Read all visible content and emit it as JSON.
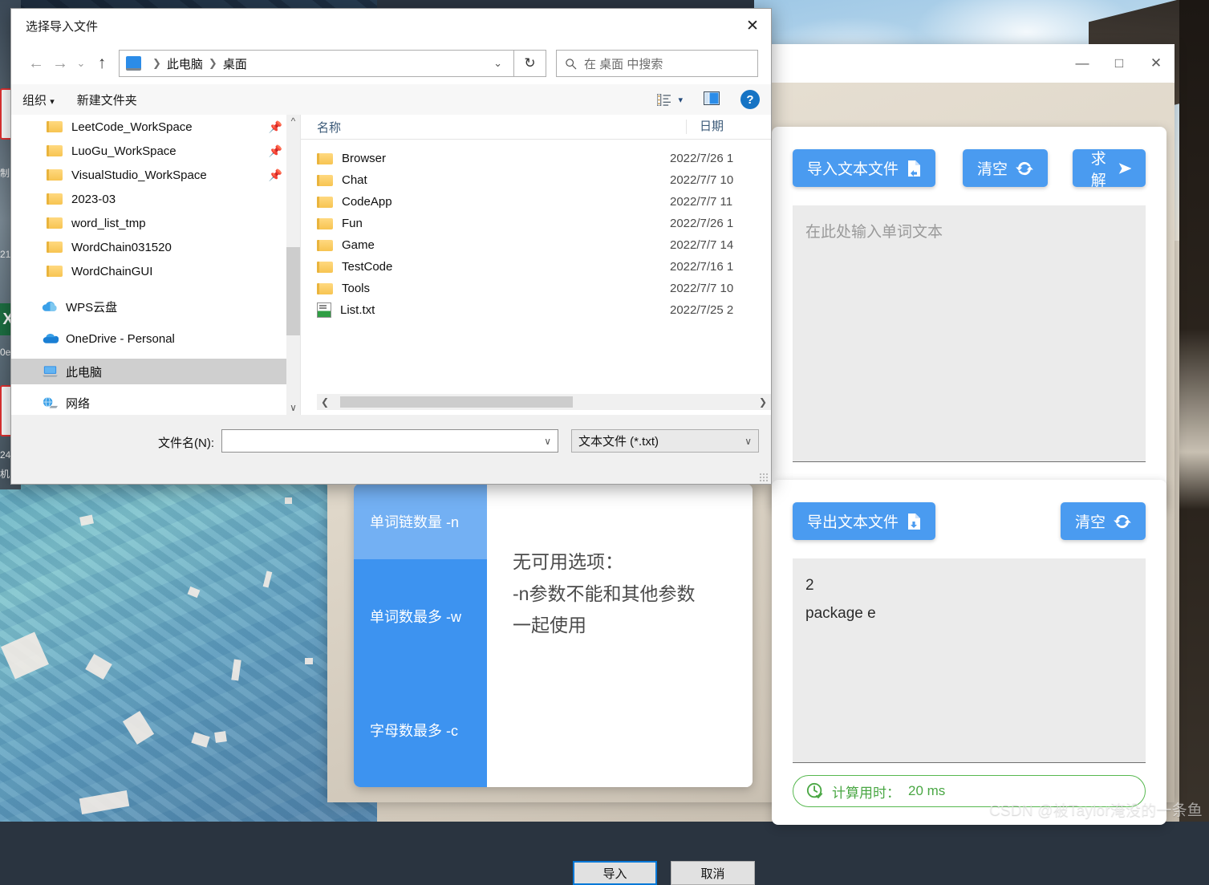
{
  "desktop": {
    "watermark": "CSDN @被Taylor淹没的一条鱼"
  },
  "app_window": {
    "title": "",
    "controls": {
      "minimize": "—",
      "maximize": "□",
      "close": "✕"
    },
    "tab_card": {
      "tabs": [
        {
          "label": "单词链数量 -n",
          "active": true
        },
        {
          "label": "单词数最多 -w",
          "active": false
        },
        {
          "label": "字母数最多 -c",
          "active": false
        }
      ],
      "pane_lines": [
        "无可用选项：",
        "-n参数不能和其他参数",
        "一起使用"
      ]
    },
    "input_card": {
      "import_button": "导入文本文件",
      "clear_button": "清空",
      "solve_button": "求解",
      "textarea_placeholder": "在此处输入单词文本",
      "textarea_value": ""
    },
    "output_card": {
      "export_button": "导出文本文件",
      "clear_button": "清空",
      "textarea_value": "2\npackage e",
      "timer_label": "计算用时：",
      "timer_value": "20 ms",
      "timer_color": "#4aa744"
    },
    "accent_color": "#4a9bf0"
  },
  "file_dialog": {
    "title": "选择导入文件",
    "close_label": "✕",
    "nav": {
      "back": "←",
      "forward": "→",
      "history": "⌄",
      "up": "↑",
      "breadcrumb": [
        "此电脑",
        "桌面"
      ],
      "breadcrumb_caret": "⌄",
      "refresh": "↻",
      "search_placeholder": "在 桌面 中搜索"
    },
    "toolbar": {
      "organize": "组织",
      "organize_caret": "▾",
      "new_folder": "新建文件夹",
      "view_caret": "▾",
      "help": "?"
    },
    "tree": [
      {
        "label": "LeetCode_WorkSpace",
        "icon": "folder-icon",
        "pinned": true
      },
      {
        "label": "LuoGu_WorkSpace",
        "icon": "folder-icon",
        "pinned": true
      },
      {
        "label": "VisualStudio_WorkSpace",
        "icon": "folder-icon",
        "pinned": true
      },
      {
        "label": "2023-03",
        "icon": "folder-icon",
        "pinned": false
      },
      {
        "label": "word_list_tmp",
        "icon": "folder-icon",
        "pinned": false
      },
      {
        "label": "WordChain031520",
        "icon": "folder-icon",
        "pinned": false
      },
      {
        "label": "WordChainGUI",
        "icon": "folder-icon",
        "pinned": false
      },
      {
        "label": "WPS云盘",
        "icon": "cloud-icon",
        "pinned": false
      },
      {
        "label": "OneDrive - Personal",
        "icon": "onedrive-icon",
        "pinned": false
      },
      {
        "label": "此电脑",
        "icon": "computer-icon",
        "pinned": false,
        "selected": true
      },
      {
        "label": "网络",
        "icon": "network-icon",
        "pinned": false
      }
    ],
    "list": {
      "columns": [
        "名称",
        "日期"
      ],
      "rows": [
        {
          "name": "Browser",
          "icon": "folder-icon",
          "date": "2022/7/26 1"
        },
        {
          "name": "Chat",
          "icon": "folder-icon",
          "date": "2022/7/7 10"
        },
        {
          "name": "CodeApp",
          "icon": "folder-icon",
          "date": "2022/7/7 11"
        },
        {
          "name": "Fun",
          "icon": "folder-icon",
          "date": "2022/7/26 1"
        },
        {
          "name": "Game",
          "icon": "folder-icon",
          "date": "2022/7/7 14"
        },
        {
          "name": "TestCode",
          "icon": "folder-icon",
          "date": "2022/7/16 1"
        },
        {
          "name": "Tools",
          "icon": "folder-icon",
          "date": "2022/7/7 10"
        },
        {
          "name": "List.txt",
          "icon": "textfile-icon",
          "date": "2022/7/25 2"
        }
      ]
    },
    "footer": {
      "filename_label": "文件名(N):",
      "filename_value": "",
      "filetype_value": "文本文件 (*.txt)",
      "open_button": "导入",
      "cancel_button": "取消"
    }
  }
}
